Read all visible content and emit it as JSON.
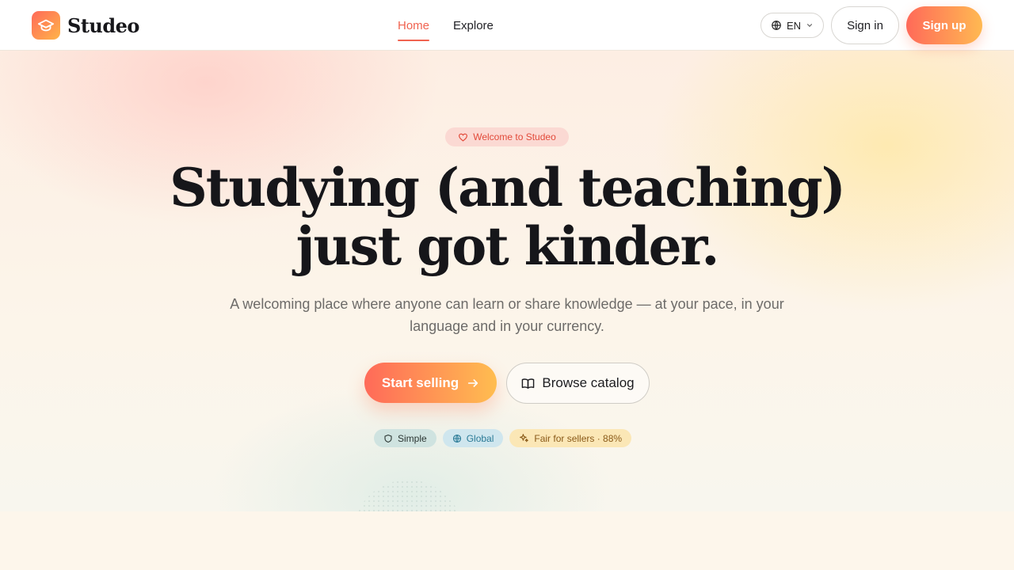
{
  "brand": {
    "name": "Studeo",
    "icon": "graduation-cap-icon",
    "gradient": [
      "#ff6a59",
      "#ffb44a"
    ]
  },
  "nav": {
    "items": [
      {
        "label": "Home",
        "active": true
      },
      {
        "label": "Explore",
        "active": false
      }
    ]
  },
  "header": {
    "language": "EN",
    "signin_label": "Sign in",
    "signup_label": "Sign up"
  },
  "hero": {
    "welcome": "Welcome to Studeo",
    "headline": "Studying (and teaching) just got kinder.",
    "subtitle": "A welcoming place where anyone can learn or share knowledge — at your pace, in your language and in your currency.",
    "primary_cta": "Start selling",
    "secondary_cta": "Browse catalog",
    "badges": [
      {
        "label": "Simple",
        "icon": "shield-icon"
      },
      {
        "label": "Global",
        "icon": "globe-icon"
      },
      {
        "label": "Fair for sellers · 88%",
        "icon": "sparkles-icon"
      }
    ]
  },
  "colors": {
    "accent": "#f06350",
    "accent_light": "#ffb952",
    "text": "#16161a"
  }
}
